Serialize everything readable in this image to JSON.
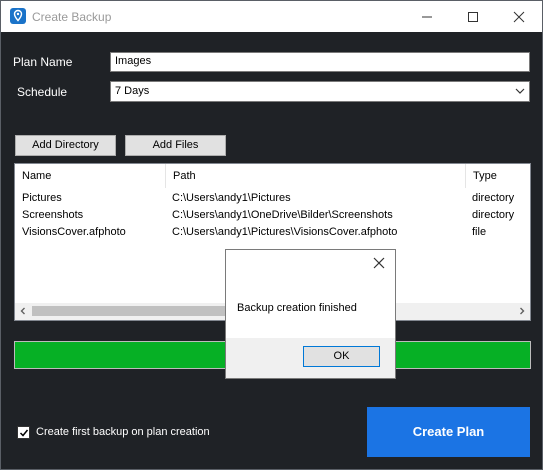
{
  "window": {
    "title": "Create Backup"
  },
  "form": {
    "plan_name_label": "Plan Name",
    "plan_name_value": "Images",
    "schedule_label": "Schedule",
    "schedule_value": "7 Days"
  },
  "toolbar": {
    "add_directory": "Add Directory",
    "add_files": "Add Files"
  },
  "table": {
    "columns": [
      "Name",
      "Path",
      "Type"
    ],
    "rows": [
      [
        "Pictures",
        "C:\\Users\\andy1\\Pictures",
        "directory"
      ],
      [
        "Screenshots",
        "C:\\Users\\andy1\\OneDrive\\Bilder\\Screenshots",
        "directory"
      ],
      [
        "VisionsCover.afphoto",
        "C:\\Users\\andy1\\Pictures\\VisionsCover.afphoto",
        "file"
      ]
    ]
  },
  "progress": {
    "value_fraction": 1.0,
    "color": "#06b025"
  },
  "options": {
    "first_backup_label": "Create first backup on plan creation",
    "first_backup_checked": true
  },
  "actions": {
    "create_plan": "Create Plan",
    "accent": "#1b74e4"
  },
  "dialog": {
    "message": "Backup creation finished",
    "ok_label": "OK"
  },
  "icons": [
    "app-icon",
    "minimize-icon",
    "maximize-icon",
    "close-icon",
    "chevron-down-icon",
    "checkmark-icon",
    "arrow-left-icon",
    "arrow-right-icon"
  ]
}
